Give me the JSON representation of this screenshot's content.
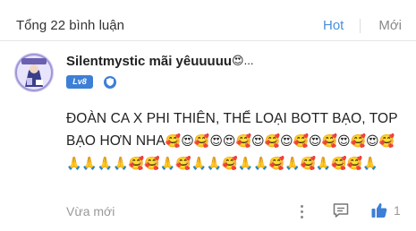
{
  "header": {
    "count_label": "Tổng 22 bình luận",
    "tab_hot": "Hot",
    "tab_new": "Mới"
  },
  "comment": {
    "username": "Silentmystic mãi yêuuuuu",
    "username_suffix": "😍...",
    "level": "Lv8",
    "text": "ĐOÀN CA X PHI THIÊN, THỂ LOẠI BOTT BẠO, TOP BẠO HƠN NHA",
    "emojis": "🥰😍🥰😍😍🥰😍🥰😍🥰😍🥰😍🥰😍🥰🙏🙏🙏🙏🥰🥰🙏🥰🙏🙏🥰🙏🙏🥰🙏🥰🙏🥰🥰🙏",
    "time": "Vừa mới",
    "likes": "1",
    "colors": {
      "accent": "#3d7fd6",
      "hot_tab": "#4a90d9",
      "muted": "#999999"
    },
    "icons": [
      "avatar",
      "level-badge",
      "shield-icon",
      "more-icon",
      "reply-icon",
      "like-icon"
    ]
  }
}
